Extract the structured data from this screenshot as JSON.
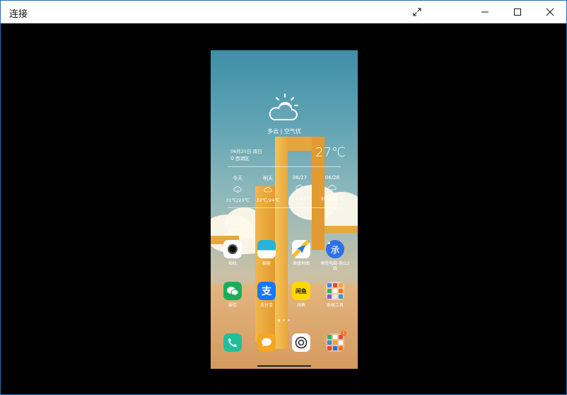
{
  "window": {
    "title": "连接"
  },
  "weather": {
    "condition": "多云 | 空气优",
    "date": "06月25日 周日",
    "location": "西湖区",
    "temperature": "27℃",
    "forecast": [
      {
        "day": "今天",
        "temp": "31℃/23℃"
      },
      {
        "day": "明天",
        "temp": "32℃/24℃"
      },
      {
        "day": "06/27",
        "temp": "33℃/25℃"
      },
      {
        "day": "06/28",
        "temp": "35℃/26℃"
      }
    ]
  },
  "apps": [
    {
      "label": "相机",
      "icon": "camera-icon"
    },
    {
      "label": "相册",
      "icon": "gallery-icon"
    },
    {
      "label": "高德地图",
      "icon": "amap-icon"
    },
    {
      "label": "承院电脑·奥山2线",
      "icon": "cheng-app-icon",
      "glyph": "承"
    },
    {
      "label": "微信",
      "icon": "wechat-icon"
    },
    {
      "label": "支付宝",
      "icon": "alipay-icon",
      "glyph": "支"
    },
    {
      "label": "闲鱼",
      "icon": "xianyu-icon",
      "glyph": "闲鱼"
    },
    {
      "label": "系统工具",
      "icon": "system-tools-folder-icon"
    }
  ],
  "dock": [
    {
      "icon": "phone-icon"
    },
    {
      "icon": "messages-icon"
    },
    {
      "icon": "browser-icon"
    },
    {
      "icon": "app-folder-icon",
      "badge": "1"
    }
  ],
  "colors": {
    "titlebar_bg": "#ffffff",
    "content_bg": "#000000",
    "window_border": "#2b6cb0"
  }
}
